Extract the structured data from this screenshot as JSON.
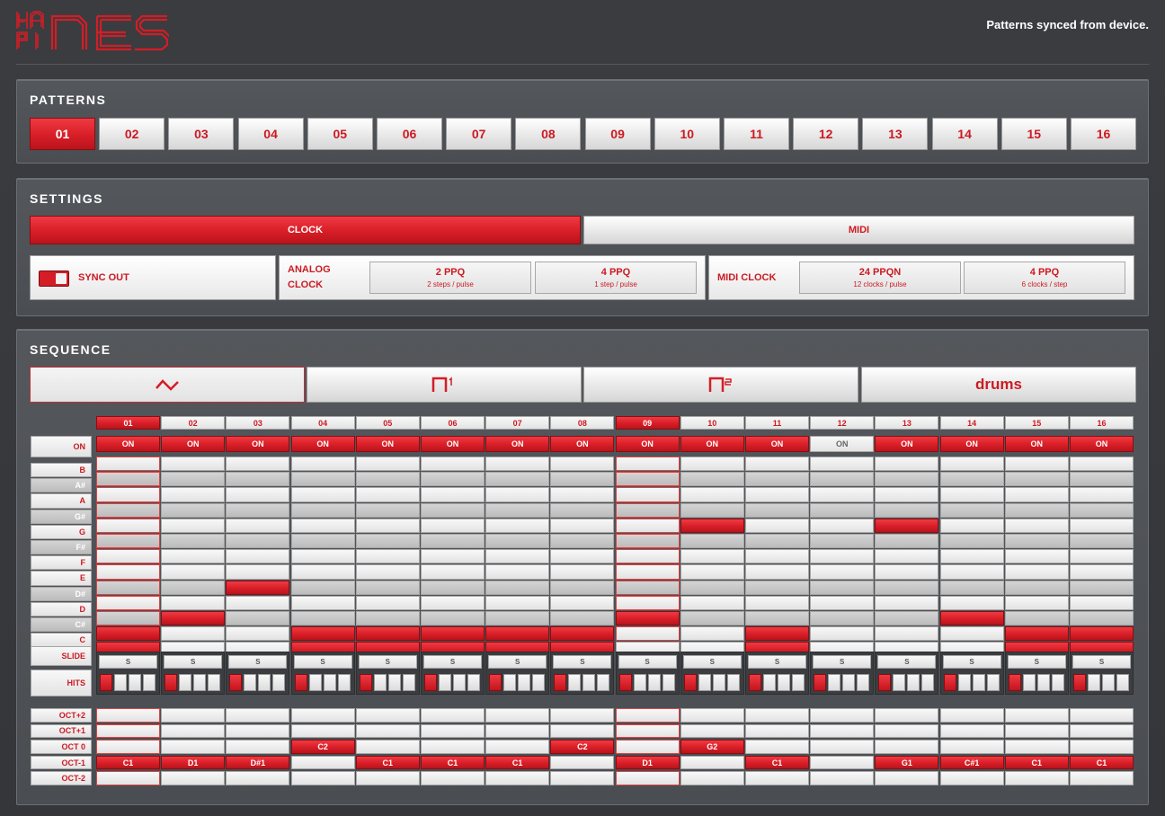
{
  "header": {
    "logo": "HAPI NES",
    "status": "Patterns synced from device."
  },
  "patterns": {
    "title": "PATTERNS",
    "active": 0,
    "items": [
      "01",
      "02",
      "03",
      "04",
      "05",
      "06",
      "07",
      "08",
      "09",
      "10",
      "11",
      "12",
      "13",
      "14",
      "15",
      "16"
    ]
  },
  "settings": {
    "title": "SETTINGS",
    "tabs": [
      "CLOCK",
      "MIDI"
    ],
    "active_tab": 0,
    "sync_out": "SYNC OUT",
    "sync_on": true,
    "analog_line1": "ANALOG",
    "analog_line2": "CLOCK",
    "analog_options": [
      {
        "main": "2 PPQ",
        "sub": "2 steps / pulse"
      },
      {
        "main": "4 PPQ",
        "sub": "1 step / pulse"
      }
    ],
    "midi_clock": "MIDI CLOCK",
    "midi_options": [
      {
        "main": "24 PPQN",
        "sub": "12 clocks / pulse"
      },
      {
        "main": "4 PPQ",
        "sub": "6 clocks / step"
      }
    ]
  },
  "sequence": {
    "title": "SEQUENCE",
    "channels": [
      "triangle-icon",
      "pulse-1-icon",
      "pulse-2-icon",
      "drums"
    ],
    "drums_label": "drums",
    "active_channel": 0,
    "current_step": 8,
    "steps": [
      "01",
      "02",
      "03",
      "04",
      "05",
      "06",
      "07",
      "08",
      "09",
      "10",
      "11",
      "12",
      "13",
      "14",
      "15",
      "16"
    ],
    "on_label": "ON",
    "on_states": [
      true,
      true,
      true,
      true,
      true,
      true,
      true,
      true,
      true,
      true,
      true,
      false,
      true,
      true,
      true,
      true
    ],
    "notes": [
      "B",
      "A#",
      "A",
      "G#",
      "G",
      "F#",
      "F",
      "E",
      "D#",
      "D",
      "C#",
      "C"
    ],
    "note_per_step": [
      "C",
      "C#",
      "D#",
      "C",
      "C",
      "C",
      "C",
      "C",
      "C#",
      "G",
      "C",
      "",
      "G",
      "C#",
      "C",
      "C"
    ],
    "slide_label": "SLIDE",
    "slide_btn": "S",
    "hits_label": "HITS",
    "octaves": [
      "OCT+2",
      "OCT+1",
      "OCT 0",
      "OCT-1",
      "OCT-2"
    ],
    "octave_cells": [
      {
        "row": 3,
        "label": "C1"
      },
      {
        "row": 3,
        "label": "D1"
      },
      {
        "row": 3,
        "label": "D#1"
      },
      {
        "row": 2,
        "label": "C2"
      },
      {
        "row": 3,
        "label": "C1"
      },
      {
        "row": 3,
        "label": "C1"
      },
      {
        "row": 3,
        "label": "C1"
      },
      {
        "row": 2,
        "label": "C2"
      },
      {
        "row": 3,
        "label": "D1"
      },
      {
        "row": 2,
        "label": "G2"
      },
      {
        "row": 3,
        "label": "C1"
      },
      {
        "row": -1,
        "label": ""
      },
      {
        "row": 3,
        "label": "G1"
      },
      {
        "row": 3,
        "label": "C#1"
      },
      {
        "row": 3,
        "label": "C1"
      },
      {
        "row": 3,
        "label": "C1"
      }
    ]
  },
  "colors": {
    "accent": "#d81e27",
    "panel": "#4e5155",
    "background": "#36383c"
  }
}
